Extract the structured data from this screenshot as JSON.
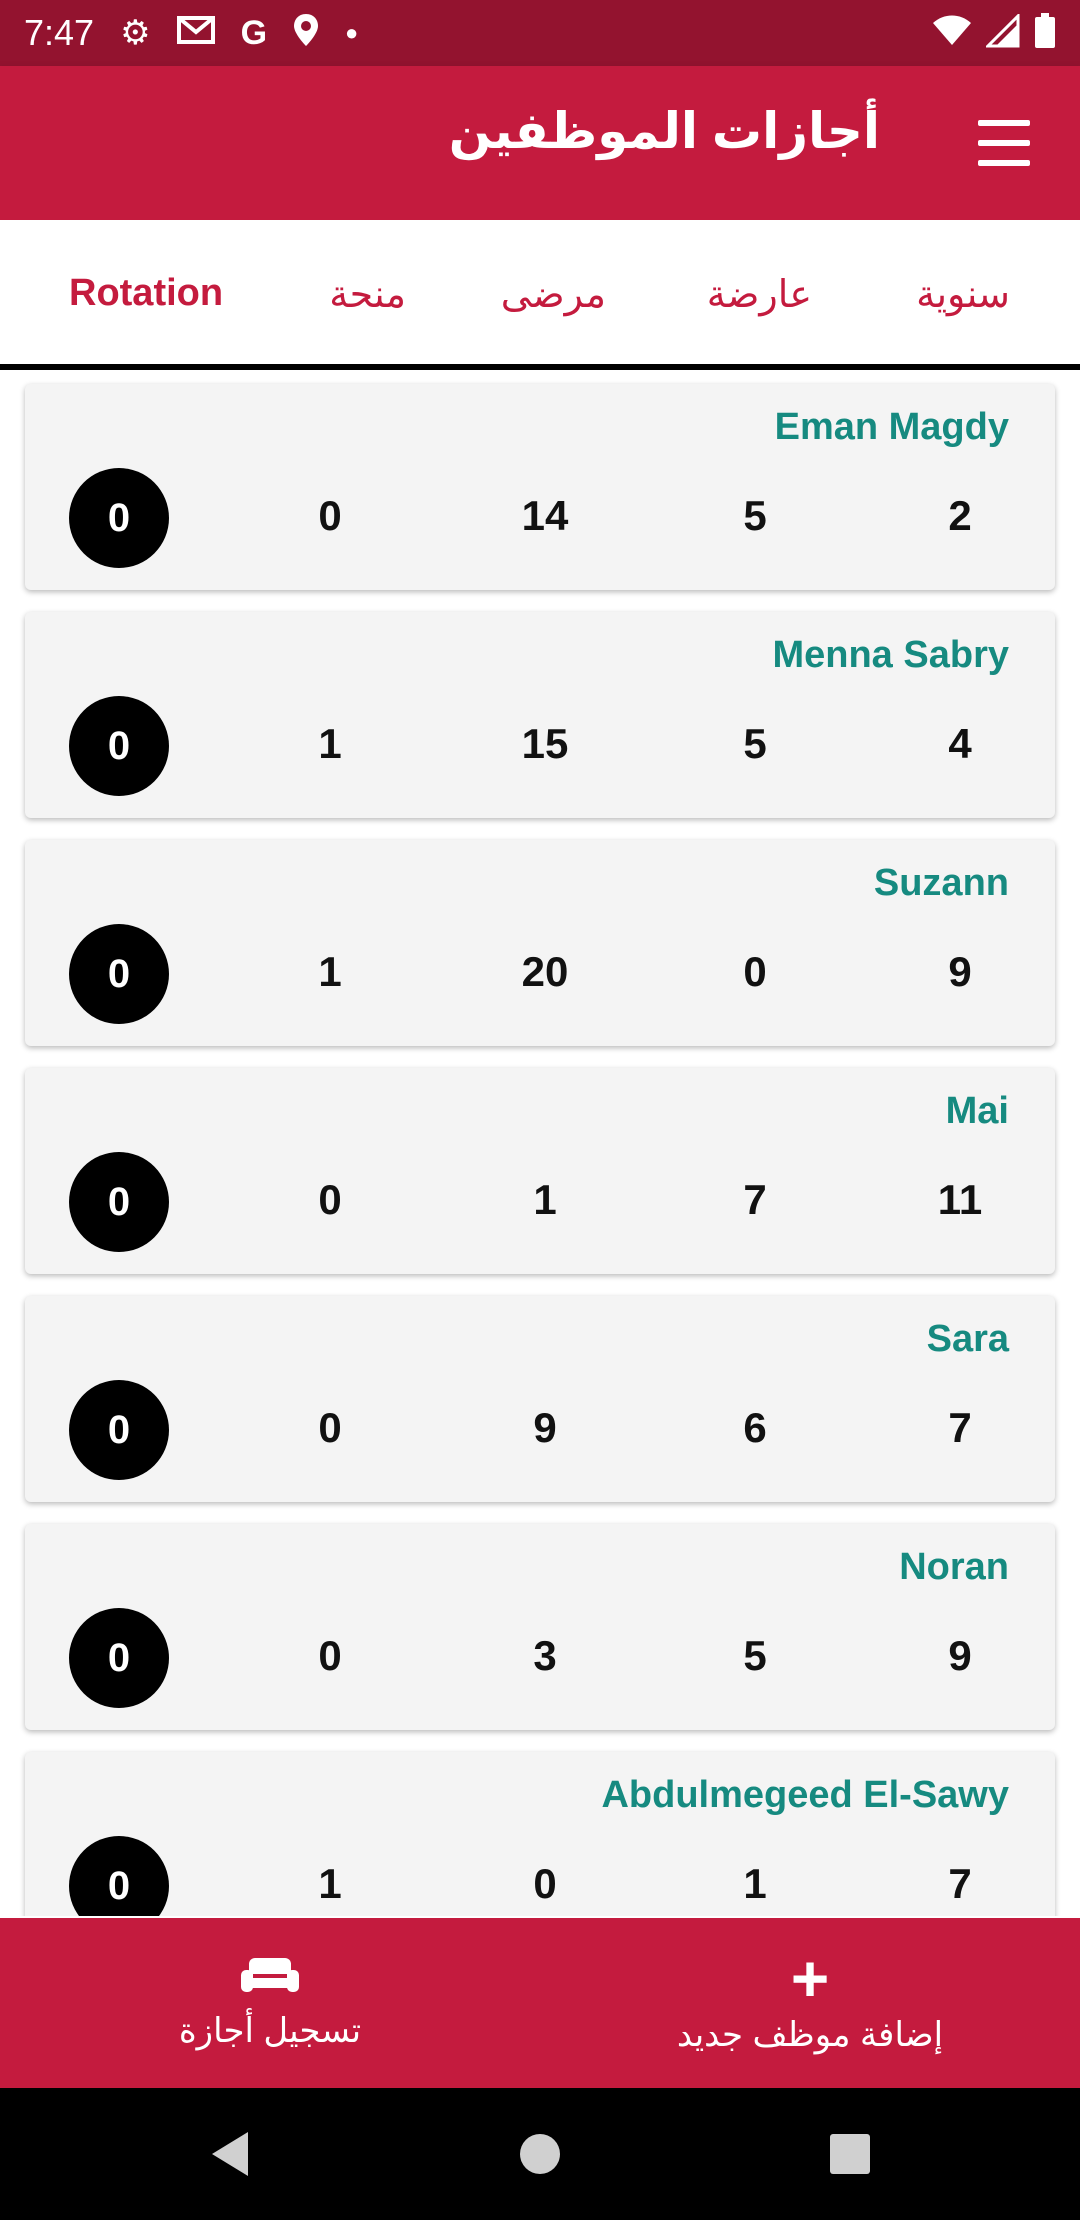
{
  "status_bar": {
    "time": "7:47",
    "left_icons": [
      "settings-icon",
      "gmail-icon",
      "google-icon",
      "location-icon",
      "dot-icon"
    ],
    "right_icons": [
      "wifi-icon",
      "signal-icon",
      "battery-icon"
    ]
  },
  "app_bar": {
    "title": "أجازات الموظفين",
    "menu_icon": "hamburger-menu-icon"
  },
  "tabs": [
    {
      "label": "سنوية",
      "active": false
    },
    {
      "label": "عارضة",
      "active": false
    },
    {
      "label": "مرضى",
      "active": false
    },
    {
      "label": "منحة",
      "active": false
    },
    {
      "label": "Rotation",
      "active": true
    }
  ],
  "employees": [
    {
      "name": "Eman Magdy",
      "badge": "0",
      "values": [
        "0",
        "14",
        "5",
        "2"
      ]
    },
    {
      "name": "Menna Sabry",
      "badge": "0",
      "values": [
        "1",
        "15",
        "5",
        "4"
      ]
    },
    {
      "name": "Suzann",
      "badge": "0",
      "values": [
        "1",
        "20",
        "0",
        "9"
      ]
    },
    {
      "name": "Mai",
      "badge": "0",
      "values": [
        "0",
        "1",
        "7",
        "11"
      ]
    },
    {
      "name": "Sara",
      "badge": "0",
      "values": [
        "0",
        "9",
        "6",
        "7"
      ]
    },
    {
      "name": "Noran",
      "badge": "0",
      "values": [
        "0",
        "3",
        "5",
        "9"
      ]
    },
    {
      "name": "Abdulmegeed El-Sawy",
      "badge": "0",
      "values": [
        "1",
        "0",
        "1",
        "7"
      ]
    }
  ],
  "bottom_nav": {
    "left": {
      "label": "تسجيل أجازة",
      "icon": "sofa-icon"
    },
    "right": {
      "label": "إضافة موظف جديد",
      "icon": "plus-icon"
    }
  },
  "colors": {
    "status_bar": "#93132f",
    "primary": "#c41b3e",
    "name_text": "#168a80",
    "card_bg": "#f4f4f4"
  }
}
